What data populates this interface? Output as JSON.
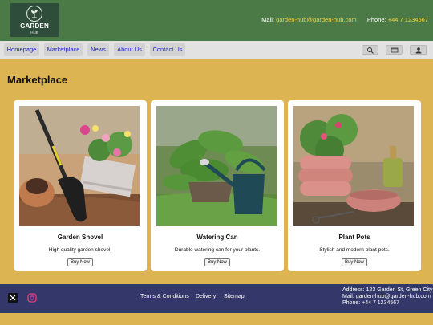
{
  "header": {
    "logo": {
      "name": "GARDEN",
      "sub": "HUB"
    },
    "contact": {
      "mail_label": "Mail:",
      "mail_value": "garden-hub@garden-hub.com",
      "phone_label": "Phone:",
      "phone_value": "+44 7 1234567"
    }
  },
  "nav": {
    "items": [
      {
        "label": "Homepage"
      },
      {
        "label": "Marketplace"
      },
      {
        "label": "News"
      },
      {
        "label": "About Us"
      },
      {
        "label": "Contact Us"
      }
    ],
    "utility_icons": [
      "search-icon",
      "cart-icon",
      "user-icon"
    ]
  },
  "main": {
    "title": "Marketplace",
    "products": [
      {
        "name": "Garden Shovel",
        "description": "High quality garden shovel.",
        "button": "Buy Now",
        "image": "garden-shovel-photo"
      },
      {
        "name": "Watering Can",
        "description": "Durable watering can for your plants.",
        "button": "Buy Now",
        "image": "watering-can-photo"
      },
      {
        "name": "Plant Pots",
        "description": "Stylish and modern plant pots.",
        "button": "Buy Now",
        "image": "plant-pots-photo"
      }
    ]
  },
  "footer": {
    "social_icons": [
      "x-icon",
      "instagram-icon"
    ],
    "links": [
      {
        "label": "Terms & Conditions"
      },
      {
        "label": "Delivery"
      },
      {
        "label": "Sitemap"
      }
    ],
    "address_lines": [
      "Address: 123 Garden St, Green City",
      "Mail: garden-hub@garden-hub.com",
      "Phone: +44 7 1234567"
    ]
  },
  "colors": {
    "header_bg": "#4b7a47",
    "page_bg": "#dcb452",
    "nav_bg": "#e2e2e2",
    "footer_bg": "#343769",
    "contact_value": "#f3d23c",
    "nav_link": "#2222cc"
  }
}
